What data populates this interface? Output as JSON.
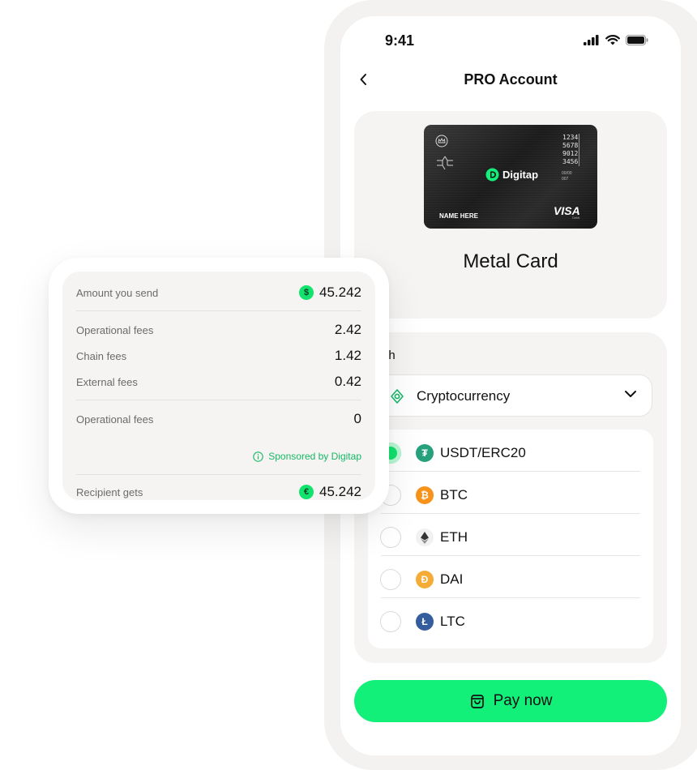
{
  "status_bar": {
    "time": "9:41"
  },
  "nav": {
    "title": "PRO Account"
  },
  "card": {
    "number_lines": [
      "1234",
      "5678",
      "9012",
      "3456"
    ],
    "brand": "Digitap",
    "valid_label": "00/00",
    "cvv": "007",
    "holder": "NAME HERE",
    "network": "VISA",
    "network_sub": "Debit",
    "title": "Metal Card"
  },
  "pay": {
    "label": "with",
    "method": {
      "value": "Cryptocurrency",
      "icon": "crypto-icon"
    },
    "coins": [
      {
        "label": "USDT/ERC20",
        "icon": "tether-icon",
        "color": "#26a17b",
        "glyph": "₮",
        "selected": true
      },
      {
        "label": "BTC",
        "icon": "bitcoin-icon",
        "color": "#f7931a",
        "glyph": "₿",
        "selected": false
      },
      {
        "label": "ETH",
        "icon": "ethereum-icon",
        "color": "#f1f1f1",
        "glyph": "◆",
        "selected": false
      },
      {
        "label": "DAI",
        "icon": "dai-icon",
        "color": "#f5ac37",
        "glyph": "Đ",
        "selected": false
      },
      {
        "label": "LTC",
        "icon": "litecoin-icon",
        "color": "#345d9d",
        "glyph": "Ł",
        "selected": false
      }
    ]
  },
  "pay_button": {
    "label": "Pay now"
  },
  "fees": {
    "amount_send": {
      "label": "Amount you send",
      "value": "45.242"
    },
    "operational": {
      "label": "Operational fees",
      "value": "2.42"
    },
    "chain": {
      "label": "Chain fees",
      "value": "1.42"
    },
    "external": {
      "label": "External fees",
      "value": "0.42"
    },
    "operational_sponsored": {
      "label": "Operational fees",
      "value": "0"
    },
    "sponsor_note": "Sponsored by Digitap",
    "recipient": {
      "label": "Recipient gets",
      "value": "45.242"
    }
  },
  "colors": {
    "accent": "#12f07a",
    "accent_dark": "#12e26e",
    "sponsor_text": "#15b866",
    "panel": "#f6f4f2"
  }
}
